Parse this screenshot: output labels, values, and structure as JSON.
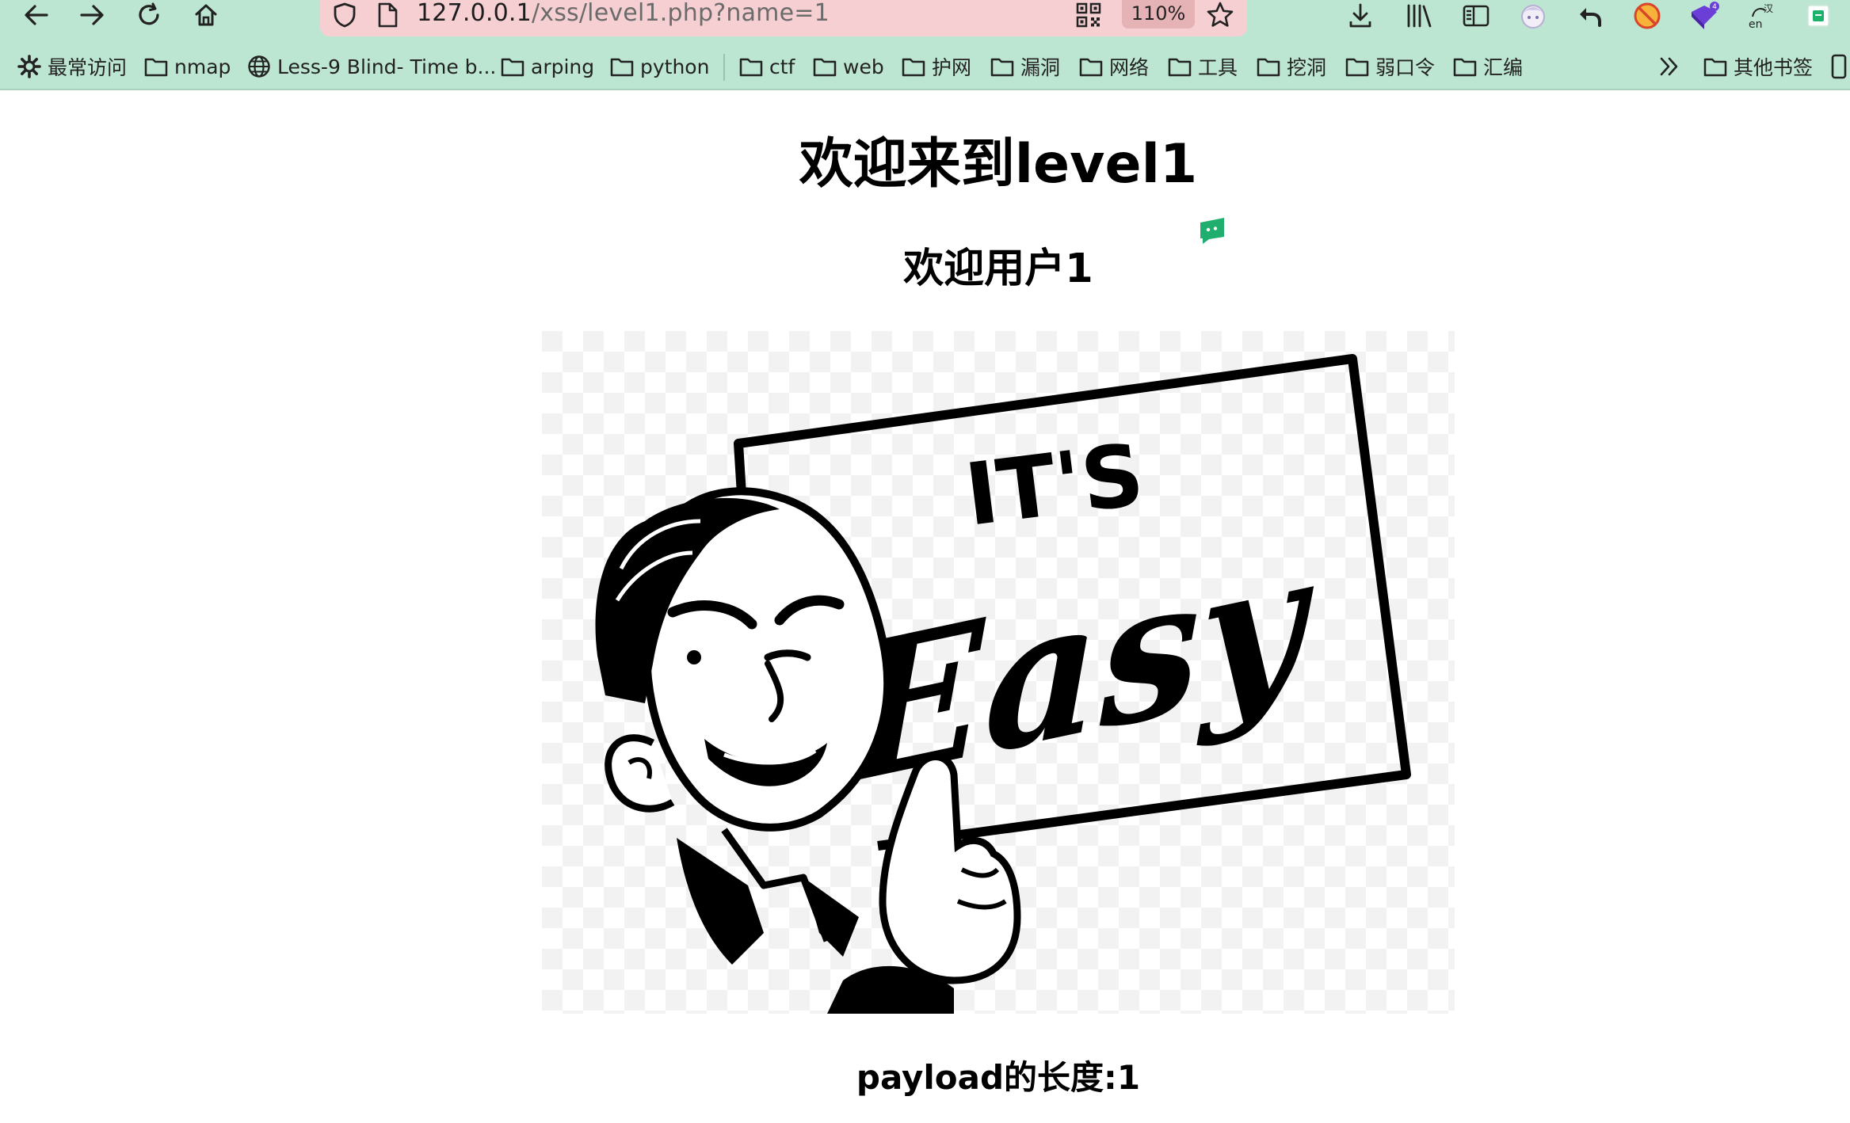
{
  "browser": {
    "url_host": "127.0.0.1",
    "url_path": "/xss/level1.php?name=1",
    "zoom": "110%",
    "bookmarks": [
      {
        "label": "最常访问",
        "icon": "gear-icon"
      },
      {
        "label": "nmap",
        "icon": "folder-icon"
      },
      {
        "label": "Less-9 Blind- Time b...",
        "icon": "globe-icon"
      },
      {
        "label": "arping",
        "icon": "folder-icon"
      },
      {
        "label": "python",
        "icon": "folder-icon"
      },
      {
        "label": "ctf",
        "icon": "folder-icon"
      },
      {
        "label": "web",
        "icon": "folder-icon"
      },
      {
        "label": "护网",
        "icon": "folder-icon"
      },
      {
        "label": "漏洞",
        "icon": "folder-icon"
      },
      {
        "label": "网络",
        "icon": "folder-icon"
      },
      {
        "label": "工具",
        "icon": "folder-icon"
      },
      {
        "label": "挖洞",
        "icon": "folder-icon"
      },
      {
        "label": "弱口令",
        "icon": "folder-icon"
      },
      {
        "label": "汇编",
        "icon": "folder-icon"
      }
    ],
    "other_bookmarks": "其他书签",
    "colors": {
      "chrome": "#bde6d2",
      "urlbar": "#f6cfd2"
    }
  },
  "page": {
    "title": "欢迎来到level1",
    "welcome": "欢迎用户1",
    "payload_length": "payload的长度:1",
    "image_text": {
      "line1": "IT'S",
      "line2": "Easy"
    }
  }
}
